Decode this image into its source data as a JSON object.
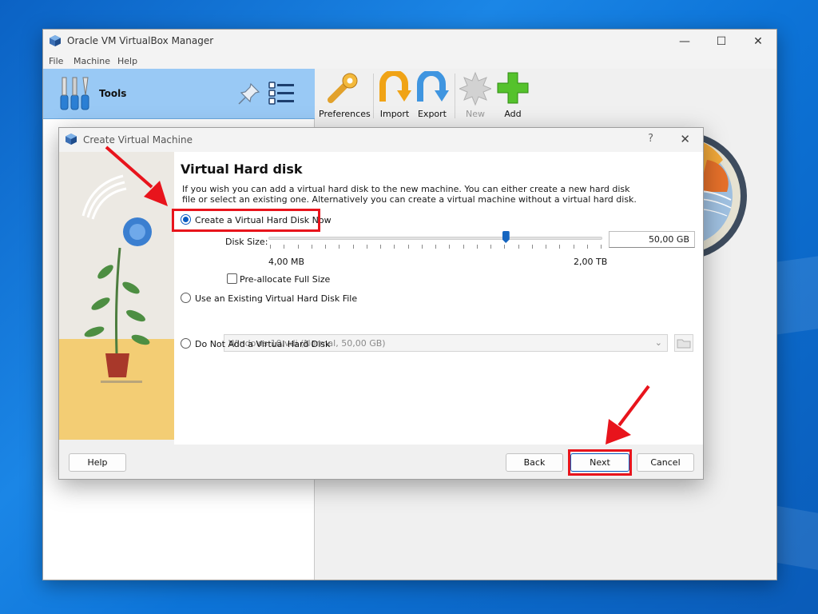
{
  "window": {
    "title": "Oracle VM VirtualBox Manager",
    "controls": {
      "minimize": "—",
      "maximize": "☐",
      "close": "✕"
    }
  },
  "menu": [
    "File",
    "Machine",
    "Help"
  ],
  "sidebar": {
    "tools_label": "Tools"
  },
  "toolbar": [
    {
      "label": "Preferences",
      "icon": "preferences-icon",
      "enabled": true
    },
    {
      "label": "Import",
      "icon": "import-icon",
      "enabled": true
    },
    {
      "label": "Export",
      "icon": "export-icon",
      "enabled": true
    },
    {
      "label": "New",
      "icon": "new-icon",
      "enabled": false
    },
    {
      "label": "Add",
      "icon": "add-icon",
      "enabled": true
    }
  ],
  "dialog": {
    "title": "Create Virtual Machine",
    "help_glyph": "?",
    "close_glyph": "✕",
    "page_title": "Virtual Hard disk",
    "description": "If you wish you can add a virtual hard disk to the new machine. You can either create a new hard disk file or select an existing one. Alternatively you can create a virtual machine without a virtual hard disk.",
    "options": {
      "create_now": {
        "label": "Create a Virtual Hard Disk Now",
        "checked": true
      },
      "use_existing": {
        "label": "Use an Existing Virtual Hard Disk File",
        "checked": false
      },
      "no_disk": {
        "label": "Do Not Add a Virtual Hard Disk",
        "checked": false
      }
    },
    "disk_size": {
      "label": "Disk Size:",
      "value": "50,00 GB",
      "min_label": "4,00 MB",
      "max_label": "2,00 TB",
      "slider_fraction": 0.71
    },
    "preallocate": {
      "label": "Pre-allocate Full Size",
      "checked": false
    },
    "existing_file": {
      "selected": "Windows 10.vdi (Normal, 50,00 GB)"
    },
    "buttons": {
      "help": "Help",
      "back": "Back",
      "next": "Next",
      "cancel": "Cancel"
    }
  },
  "colors": {
    "highlight": "#e8141c",
    "accent": "#0a5cc2",
    "tools_selected": "#99c9f5"
  }
}
